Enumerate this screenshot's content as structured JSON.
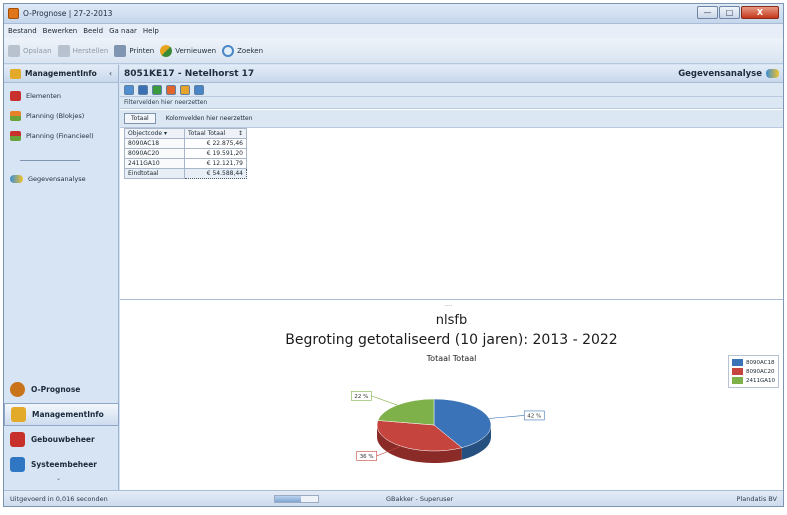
{
  "window": {
    "title": "O-Prognose | 27-2-2013",
    "controls": {
      "minimize": "—",
      "maximize": "□",
      "close": "X"
    }
  },
  "menu": [
    "Bestand",
    "Bewerken",
    "Beeld",
    "Ga naar",
    "Help"
  ],
  "toolbar": {
    "save": "Opslaan",
    "restore": "Herstellen",
    "print": "Printen",
    "refresh": "Vernieuwen",
    "search": "Zoeken"
  },
  "sidebar": {
    "header": "ManagementInfo",
    "header_chevron": "‹",
    "items": [
      {
        "label": "Elementen",
        "icon": "folder-red-icon"
      },
      {
        "label": "Planning (Blokjes)",
        "icon": "planning-icon"
      },
      {
        "label": "Planning (Financieel)",
        "icon": "planning-finance-icon"
      },
      {
        "label": "Gegevensanalyse",
        "icon": "data-analysis-icon"
      }
    ],
    "nav": [
      {
        "label": "O-Prognose",
        "icon": "gear-icon",
        "color": "#c9741b"
      },
      {
        "label": "ManagementInfo",
        "icon": "folder-icon",
        "color": "#e3a928",
        "active": true
      },
      {
        "label": "Gebouwbeheer",
        "icon": "building-icon",
        "color": "#c8312b"
      },
      {
        "label": "Systeembeheer",
        "icon": "settings-icon",
        "color": "#2f77c2"
      }
    ],
    "collapse_chevron": "⌄"
  },
  "main": {
    "page_title": "8051KE17 - Netelhorst 17",
    "section_title": "Gegevensanalyse",
    "filter_hint": "Filtervelden hier neerzetten",
    "column_chip": "Totaal",
    "column_hint": "Kolomvelden hier neerzetten",
    "splitter_dots": "....",
    "pivot": {
      "row_header": "Objectcode",
      "row_header_sort": "▾",
      "value_header": "Totaal Totaal",
      "value_header_sort": "↕",
      "rows": [
        {
          "code": "8090AC18",
          "value": "€ 22.875,46"
        },
        {
          "code": "8090AC20",
          "value": "€ 19.591,20"
        },
        {
          "code": "2411GA10",
          "value": "€ 12.121,79"
        }
      ],
      "total_label": "Eindtotaal",
      "total_value": "€ 54.588,44"
    }
  },
  "colors": {
    "accent": "#2f6fb0",
    "slice1": "#3a73b8",
    "slice2": "#c6443e",
    "slice3": "#7fb14a"
  },
  "chart_data": {
    "type": "pie",
    "title": "nlsfb",
    "subtitle": "Begroting getotaliseerd (10 jaren): 2013 - 2022",
    "series_title": "Totaal Totaal",
    "legend_position": "right",
    "categories": [
      "8090AC18",
      "8090AC20",
      "2411GA10"
    ],
    "values": [
      22875.46,
      19591.2,
      12121.79
    ],
    "labels": [
      "42 %",
      "36 %",
      "22 %"
    ]
  },
  "status": {
    "left": "Uitgevoerd in 0,016 seconden",
    "user": "GBakker - Superuser",
    "company": "Plandatis BV",
    "progress": 0.6
  }
}
